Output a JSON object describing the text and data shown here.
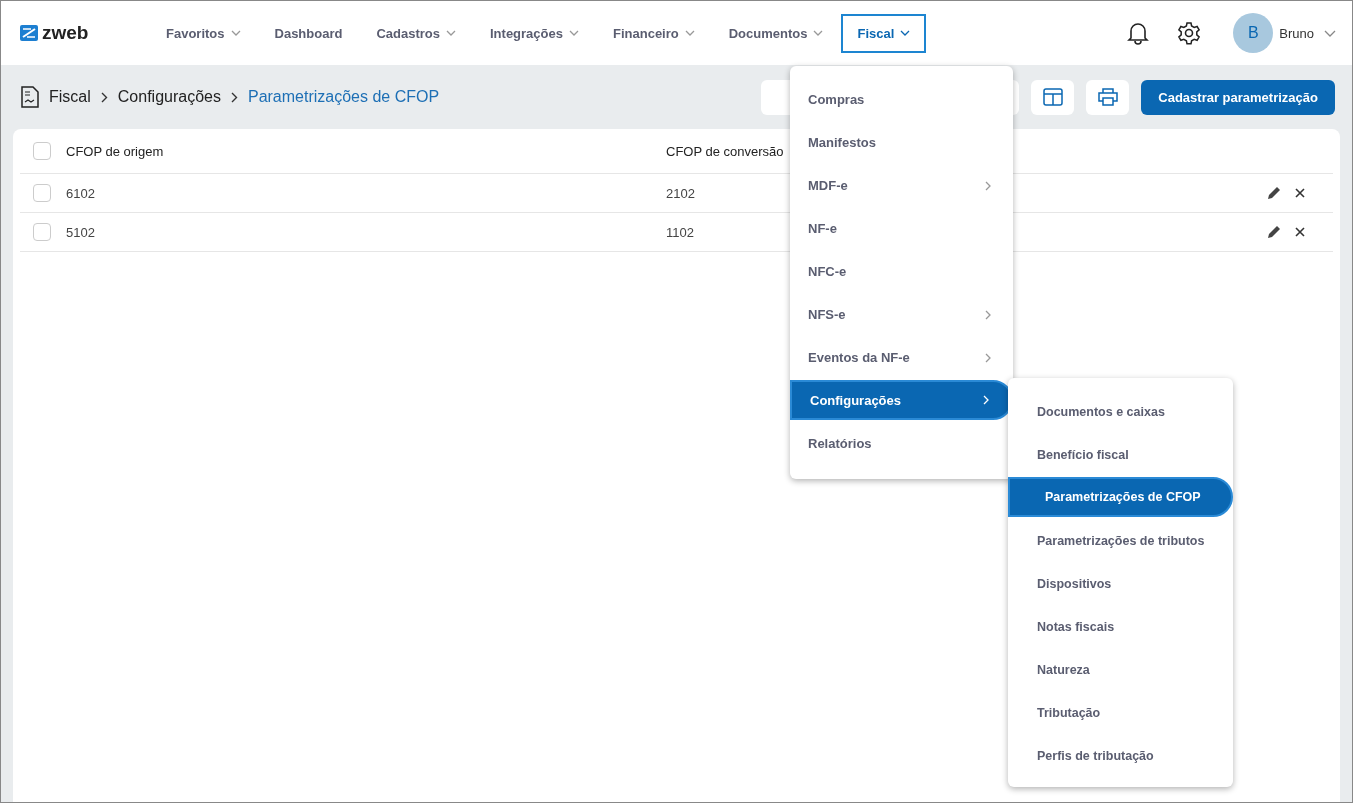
{
  "brand": {
    "name": "zweb"
  },
  "nav": [
    {
      "label": "Favoritos",
      "dropdown": true,
      "selected": false
    },
    {
      "label": "Dashboard",
      "dropdown": false,
      "selected": false
    },
    {
      "label": "Cadastros",
      "dropdown": true,
      "selected": false
    },
    {
      "label": "Integrações",
      "dropdown": true,
      "selected": false
    },
    {
      "label": "Financeiro",
      "dropdown": true,
      "selected": false
    },
    {
      "label": "Documentos",
      "dropdown": true,
      "selected": false
    },
    {
      "label": "Fiscal",
      "dropdown": true,
      "selected": true
    }
  ],
  "user": {
    "initial": "B",
    "name": "Bruno"
  },
  "breadcrumb": [
    {
      "label": "Fiscal",
      "current": false
    },
    {
      "label": "Configurações",
      "current": false
    },
    {
      "label": "Parametrizações de CFOP",
      "current": true
    }
  ],
  "primary_button": "Cadastrar parametrização",
  "table": {
    "all_checked": false,
    "columns": [
      "CFOP de origem",
      "CFOP de conversão"
    ],
    "rows": [
      {
        "cells": [
          "6102",
          "2102"
        ],
        "checked": false
      },
      {
        "cells": [
          "5102",
          "1102"
        ],
        "checked": false
      }
    ]
  },
  "fiscal_menu": [
    {
      "label": "Compras",
      "submenu": false,
      "selected": false
    },
    {
      "label": "Manifestos",
      "submenu": false,
      "selected": false
    },
    {
      "label": "MDF-e",
      "submenu": true,
      "selected": false
    },
    {
      "label": "NF-e",
      "submenu": false,
      "selected": false
    },
    {
      "label": "NFC-e",
      "submenu": false,
      "selected": false
    },
    {
      "label": "NFS-e",
      "submenu": true,
      "selected": false
    },
    {
      "label": "Eventos da NF-e",
      "submenu": true,
      "selected": false
    },
    {
      "label": "Configurações",
      "submenu": true,
      "selected": true
    },
    {
      "label": "Relatórios",
      "submenu": false,
      "selected": false
    }
  ],
  "config_submenu": [
    {
      "label": "Documentos e caixas",
      "selected": false
    },
    {
      "label": "Benefício fiscal",
      "selected": false
    },
    {
      "label": "Parametrizações de CFOP",
      "selected": true
    },
    {
      "label": "Parametrizações de tributos",
      "selected": false
    },
    {
      "label": "Dispositivos",
      "selected": false
    },
    {
      "label": "Notas fiscais",
      "selected": false
    },
    {
      "label": "Natureza",
      "selected": false
    },
    {
      "label": "Tributação",
      "selected": false
    },
    {
      "label": "Perfis de tributação",
      "selected": false
    }
  ]
}
